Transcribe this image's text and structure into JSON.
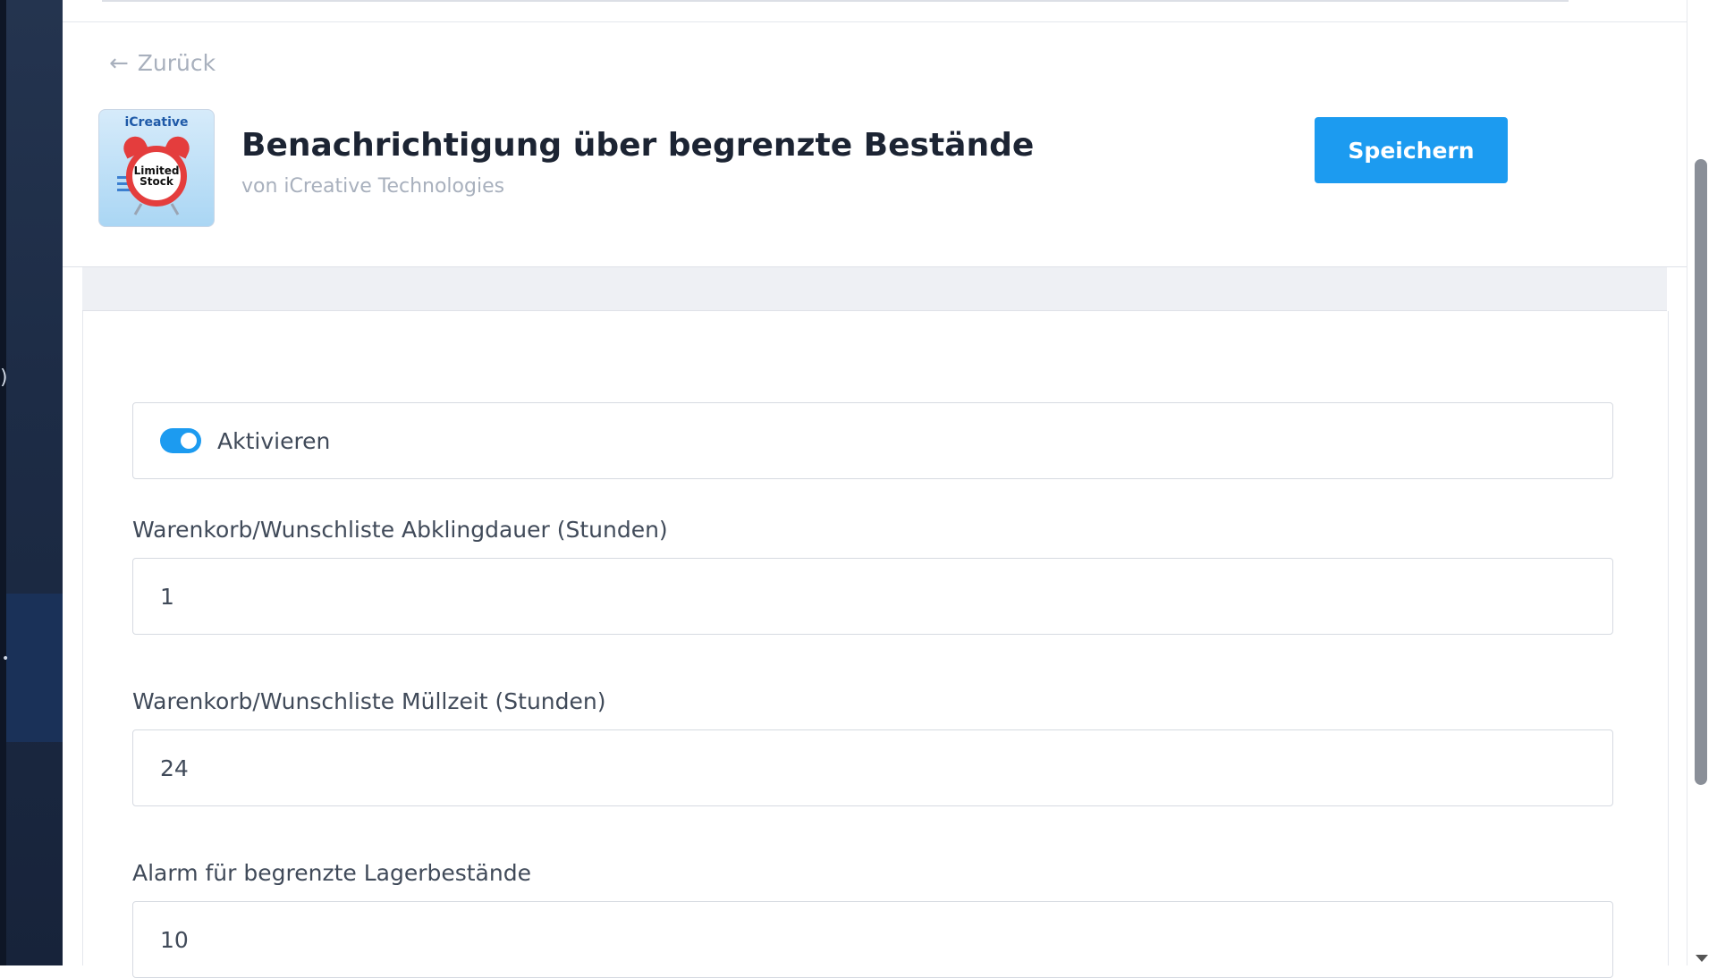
{
  "header": {
    "back_label": "Zurück",
    "app_icon": {
      "brand": "iCreative",
      "badge_text": "Limited Stock"
    },
    "title": "Benachrichtigung über begrenzte Bestände",
    "vendor": "von iCreative Technologies",
    "save_label": "Speichern"
  },
  "form": {
    "enable": {
      "label": "Aktivieren",
      "checked": true
    },
    "fields": [
      {
        "label": "Warenkorb/Wunschliste Abklingdauer (Stunden)",
        "value": "1"
      },
      {
        "label": "Warenkorb/Wunschliste Müllzeit (Stunden)",
        "value": "24"
      },
      {
        "label": "Alarm für begrenzte Lagerbestände",
        "value": "10"
      }
    ]
  },
  "colors": {
    "accent": "#1c9bf0",
    "sidebar": "#1d2c46",
    "muted_text": "#a8b0bd"
  }
}
